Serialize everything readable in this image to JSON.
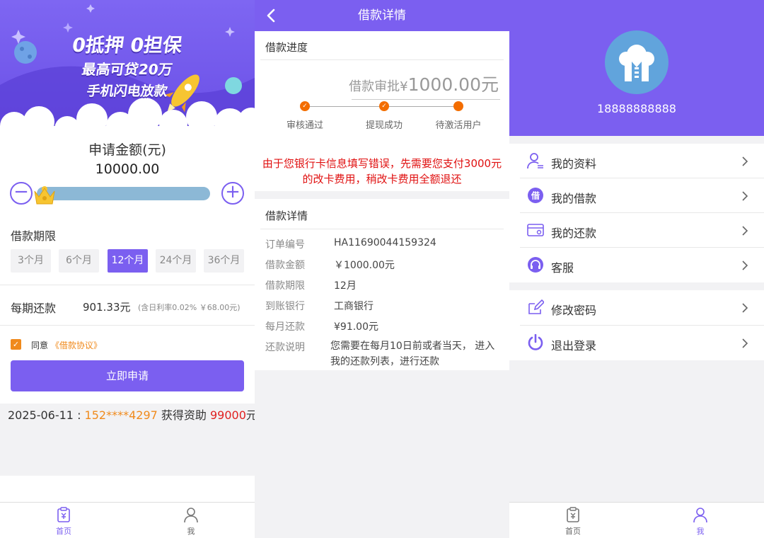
{
  "p1": {
    "banner": {
      "line1": "0抵押 0担保",
      "line2": "最高可贷20万",
      "line3": "手机闪电放款"
    },
    "apply_label": "申请金额(元)",
    "apply_amount": "10000.00",
    "minus": "−",
    "plus": "+",
    "term_title": "借款期限",
    "terms": [
      "3个月",
      "6个月",
      "12个月",
      "24个月",
      "36个月"
    ],
    "selected_term": "12个月",
    "repay_label": "每期还款",
    "repay_value": "901.33元",
    "repay_note": "(含日利率0.02% ￥68.00元)",
    "check_mark": "✓",
    "agree_text": "同意",
    "agree_link": "《借款协议》",
    "apply_button": "立即申请",
    "ticker": {
      "date": "2025-06-11 : ",
      "phone": "152****4297",
      "mid": " 获得资助 ",
      "amount": "99000",
      "suffix": "元!"
    }
  },
  "tabs": [
    {
      "label": "首页",
      "icon": "home-icon"
    },
    {
      "label": "我",
      "icon": "user-icon"
    }
  ],
  "p2": {
    "nav_title": "借款详情",
    "progress_title": "借款进度",
    "status_prefix": "借款审批¥",
    "status_amount": "1000.00元",
    "steps": [
      "审核通过",
      "提现成功",
      "待激活用户"
    ],
    "check_mark": "✓",
    "warning": "由于您银行卡信息填写错误，先需要您支付3000元的改卡费用，稍改卡费用全额退还",
    "detail_title": "借款详情",
    "details": {
      "order_label": "订单编号",
      "order_value": "HA11690044159324",
      "amount_label": "借款金额",
      "amount_value": "￥1000.00元",
      "term_label": "借款期限",
      "term_value": "12月",
      "bank_label": "到账银行",
      "bank_value": "工商银行",
      "monthly_label": "每月还款",
      "monthly_value": "¥91.00元",
      "note_label": "还款说明",
      "note_value": "您需要在每月10日前或者当天， 进入我的还款列表，进行还款"
    }
  },
  "p3": {
    "phone": "18888888888",
    "menu": [
      {
        "label": "我的资料",
        "icon": "profile-icon"
      },
      {
        "label": "我的借款",
        "icon": "borrow-icon"
      },
      {
        "label": "我的还款",
        "icon": "card-icon"
      },
      {
        "label": "客服",
        "icon": "headset-icon"
      }
    ],
    "menu2": [
      {
        "label": "修改密码",
        "icon": "edit-icon"
      },
      {
        "label": "退出登录",
        "icon": "power-icon"
      }
    ],
    "borrow_glyph": "借"
  },
  "colors": {
    "primary": "#7b5ff0",
    "orange": "#f08a1c",
    "red": "#e01010",
    "slider": "#8cb8d6"
  }
}
